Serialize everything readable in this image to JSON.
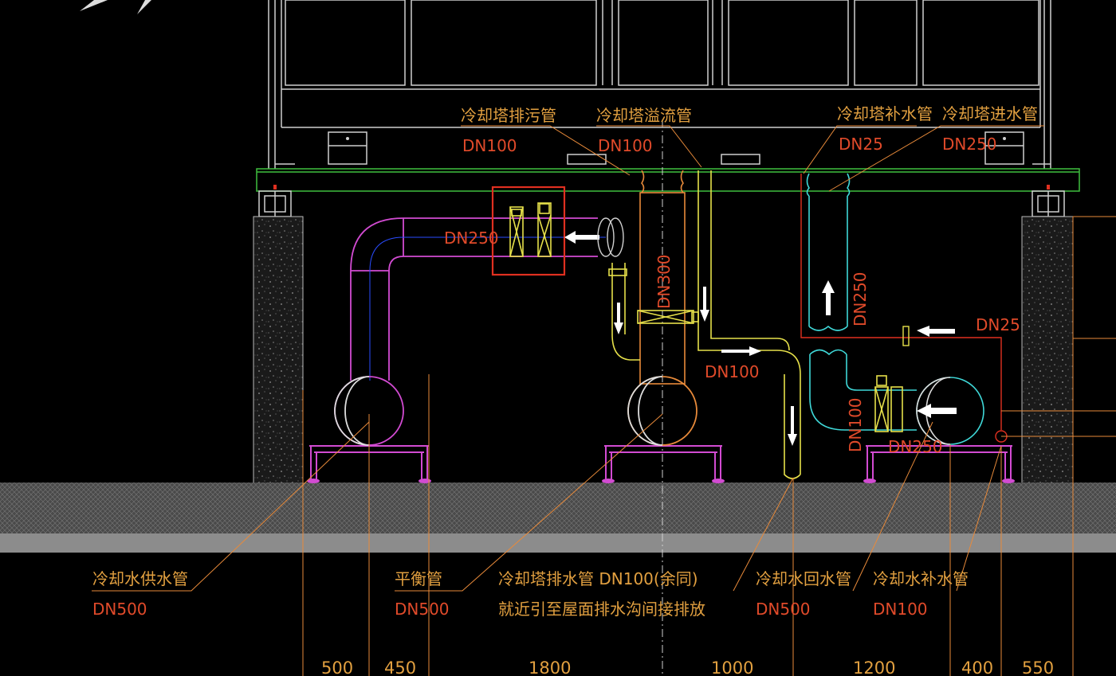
{
  "labels": {
    "drain_pipe": {
      "name": "冷却塔排污管",
      "size": "DN100"
    },
    "overflow_pipe": {
      "name": "冷却塔溢流管",
      "size": "DN100"
    },
    "makeup_pipe_top": {
      "name": "冷却塔补水管",
      "size": "DN25"
    },
    "inlet_pipe": {
      "name": "冷却塔进水管",
      "size": "DN250"
    },
    "supply_pipe": {
      "name": "冷却水供水管",
      "size": "DN500"
    },
    "balance_pipe": {
      "name": "平衡管",
      "size": "DN500"
    },
    "discharge_pipe": {
      "name": "冷却塔排水管 DN100(余同)",
      "note": "就近引至屋面排水沟间接排放"
    },
    "return_pipe": {
      "name": "冷却水回水管",
      "size": "DN500"
    },
    "makeup_pipe_bottom": {
      "name": "冷却水补水管",
      "size": "DN100"
    }
  },
  "inline_sizes": {
    "left_horizontal": "DN250",
    "center_riser": "DN300",
    "center_outlet": "DN100",
    "right_riser": "DN250",
    "makeup_branch": "DN25",
    "right_vertical": "DN100",
    "right_horizontal": "DN250"
  },
  "dimensions": [
    "500",
    "450",
    "1800",
    "1000",
    "1200",
    "400",
    "550"
  ],
  "colors": {
    "background": "#000000",
    "magenta_pipe": "#d24bd2",
    "yellow_pipe": "#e6e04a",
    "cyan_pipe": "#3fd8d8",
    "orange_pipe": "#e88a3a",
    "frame_white": "#cfcfcf",
    "green_beam": "#3fbf3f",
    "red_highlight": "#e03020",
    "blue_center": "#2a4cff",
    "label_orange": "#e2a040"
  },
  "icons": {
    "flow_arrow": "white-arrow",
    "valve": "gate-valve",
    "flexible_joint": "expansion-joint"
  }
}
